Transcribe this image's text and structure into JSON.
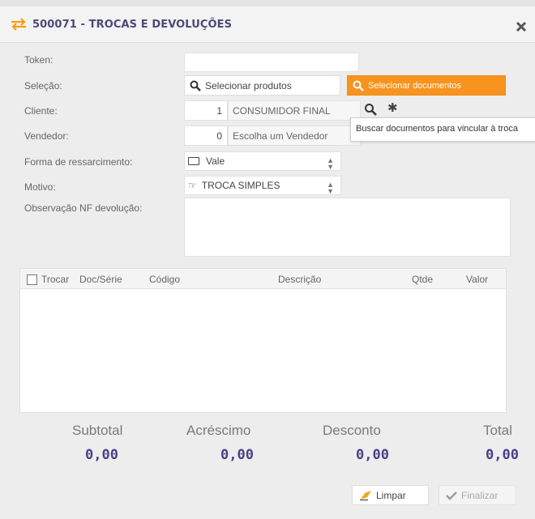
{
  "window": {
    "title": "500071 - TROCAS E DEVOLUÇÕES"
  },
  "form": {
    "token_label": "Token:",
    "token_value": "",
    "selection_label": "Seleção:",
    "select_products": "Selecionar produtos",
    "select_documents": "Selecionar documentos",
    "client_label": "Cliente:",
    "client_code": "1",
    "client_name": "CONSUMIDOR FINAL",
    "seller_label": "Vendedor:",
    "seller_code": "0",
    "seller_name": "Escolha um Vendedor",
    "refund_label": "Forma de ressarcimento:",
    "refund_value": "Vale",
    "reason_label": "Motivo:",
    "reason_value": "TROCA SIMPLES",
    "notes_label": "Observação NF devolução:",
    "notes_value": ""
  },
  "tooltip": {
    "text": "Buscar documentos para vincular à troca"
  },
  "grid": {
    "columns": [
      "Trocar",
      "Doc/Série",
      "Código",
      "Descrição",
      "Qtde",
      "Valor"
    ],
    "rows": []
  },
  "totals": {
    "subtotal_label": "Subtotal",
    "subtotal_value": "0,00",
    "increase_label": "Acréscimo",
    "increase_value": "0,00",
    "discount_label": "Desconto",
    "discount_value": "0,00",
    "total_label": "Total",
    "total_value": "0,00"
  },
  "actions": {
    "clear": "Limpar",
    "finish": "Finalizar"
  },
  "colors": {
    "accent": "#f7931e",
    "title": "#4a4a7a",
    "totals": "#4a3f86"
  }
}
